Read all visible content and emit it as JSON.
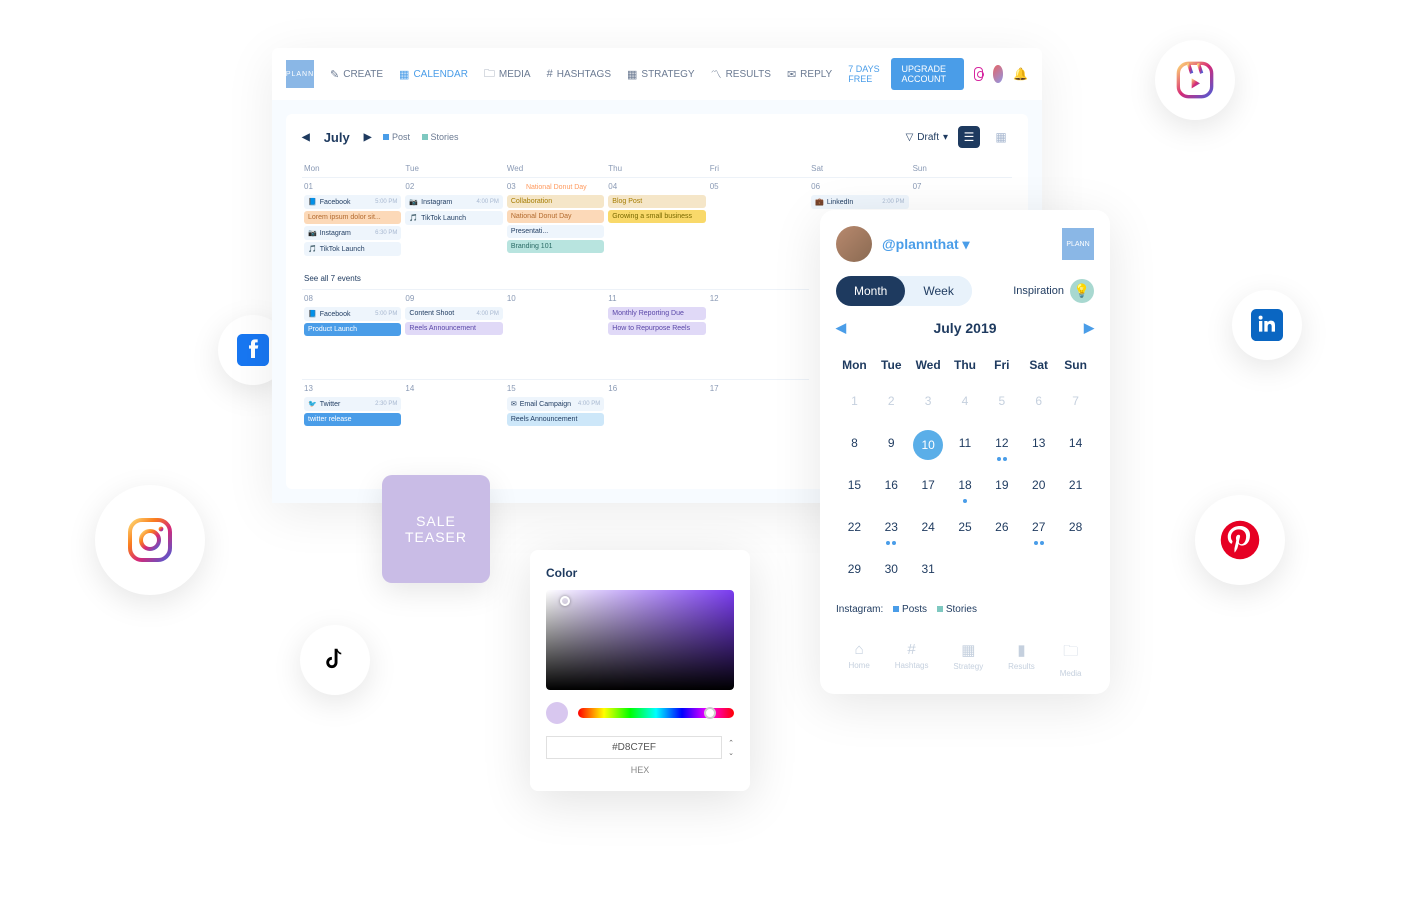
{
  "brand": "PLANN",
  "nav": {
    "create": "CREATE",
    "calendar": "CALENDAR",
    "media": "MEDIA",
    "hashtags": "HASHTAGS",
    "strategy": "STRATEGY",
    "results": "RESULTS",
    "reply": "REPLY"
  },
  "trial": "7 DAYS FREE",
  "upgrade": "UPGRADE ACCOUNT",
  "calendar": {
    "month": "July",
    "legend_post": "Post",
    "legend_stories": "Stories",
    "filter": "Draft",
    "dow": [
      "Mon",
      "Tue",
      "Wed",
      "Thu",
      "Fri",
      "Sat",
      "Sun"
    ],
    "see_all": "See all 7 events",
    "cells": {
      "01_fb": "Facebook",
      "01_fb_time": "5:00 PM",
      "01_lorem": "Lorem ipsum dolor sit...",
      "01_ig": "Instagram",
      "01_ig_time": "6:30 PM",
      "01_tik": "TikTok Launch",
      "02_ig": "Instagram",
      "02_ig_time": "4:00 PM",
      "02_tik": "TikTok Launch",
      "03_hol": "National Donut Day",
      "03_collab": "Collaboration",
      "03_donut": "National Donut Day",
      "03_pres": "Presentati...",
      "03_brand": "Branding 101",
      "04_blog": "Blog Post",
      "04_small": "Growing a small business",
      "06_li": "LinkedIn",
      "06_li_time": "2:00 PM",
      "08_fb": "Facebook",
      "08_fb_time": "5:00 PM",
      "08_launch": "Product Launch",
      "09_shoot": "Content Shoot",
      "09_shoot_time": "4:00 PM",
      "09_reels": "Reels Announcement",
      "11_report": "Monthly Reporting Due",
      "11_repurp": "How to Repurpose Reels",
      "13_tw": "Twitter",
      "13_tw_time": "2:30 PM",
      "13_rel": "twitter release",
      "15_email": "Email Campaign",
      "15_email_time": "4:00 PM",
      "15_reels": "Reels Announcement"
    }
  },
  "sale": {
    "l1": "SALE",
    "l2": "TEASER"
  },
  "picker": {
    "title": "Color",
    "hex": "#D8C7EF",
    "hex_label": "HEX"
  },
  "side": {
    "user": "@plannthat",
    "month_tab": "Month",
    "week_tab": "Week",
    "inspiration": "Inspiration",
    "month_title": "July 2019",
    "dow": [
      "Mon",
      "Tue",
      "Wed",
      "Thu",
      "Fri",
      "Sat",
      "Sun"
    ],
    "legend_label": "Instagram:",
    "legend_posts": "Posts",
    "legend_stories": "Stories",
    "bn": {
      "home": "Home",
      "hashtags": "Hashtags",
      "strategy": "Strategy",
      "results": "Results",
      "media": "Media"
    }
  },
  "mini_days": [
    "1",
    "2",
    "3",
    "4",
    "5",
    "6",
    "7",
    "8",
    "9",
    "10",
    "11",
    "12",
    "13",
    "14",
    "15",
    "16",
    "17",
    "18",
    "19",
    "20",
    "21",
    "22",
    "23",
    "24",
    "25",
    "26",
    "27",
    "28",
    "29",
    "30",
    "31"
  ]
}
